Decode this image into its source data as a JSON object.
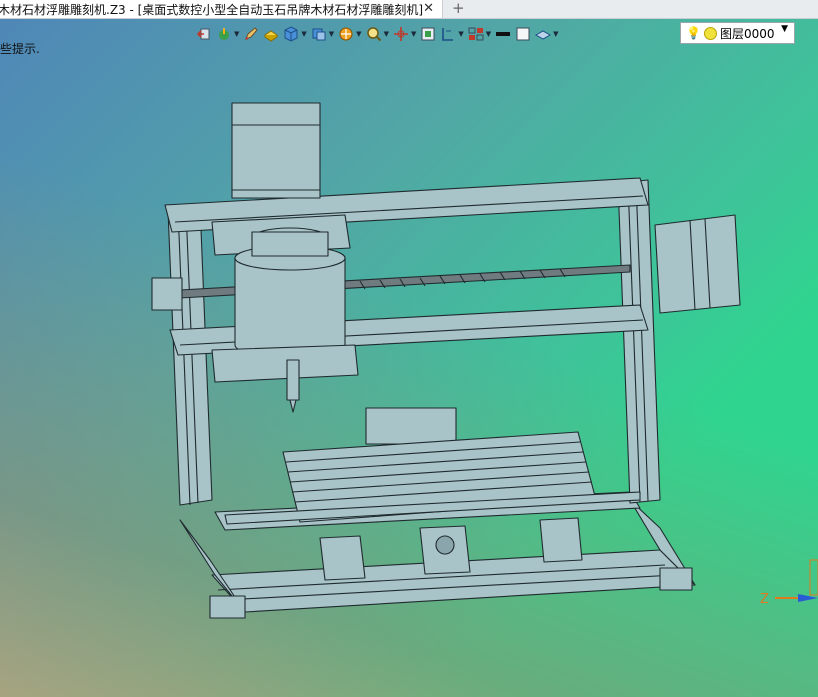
{
  "tab": {
    "title": "木材石材浮雕雕刻机.Z3 - [桌面式数控小型全自动玉石吊牌木材石材浮雕雕刻机]",
    "close_label": "✕",
    "add_label": "+"
  },
  "hint": "些提示.",
  "layer": {
    "name": "图层0000",
    "bulb_icon": "bulb-icon",
    "dropdown_icon": "chevron-down-icon"
  },
  "axis": {
    "z_label": "Z"
  },
  "colors": {
    "model_fill": "#a9c4c9",
    "model_stroke": "#1f2b2e",
    "accent_orange": "#e07a1f"
  },
  "toolbar_icons": [
    "exit-icon",
    "snap-icon",
    "pencil-icon",
    "render-mode-icon",
    "cube-view-icon",
    "view-orientation-icon",
    "render-style-icon",
    "zoom-icon",
    "pan-icon",
    "frame-icon",
    "section-icon",
    "layers-icon",
    "line-color-icon",
    "fill-color-icon",
    "plane-icon"
  ]
}
